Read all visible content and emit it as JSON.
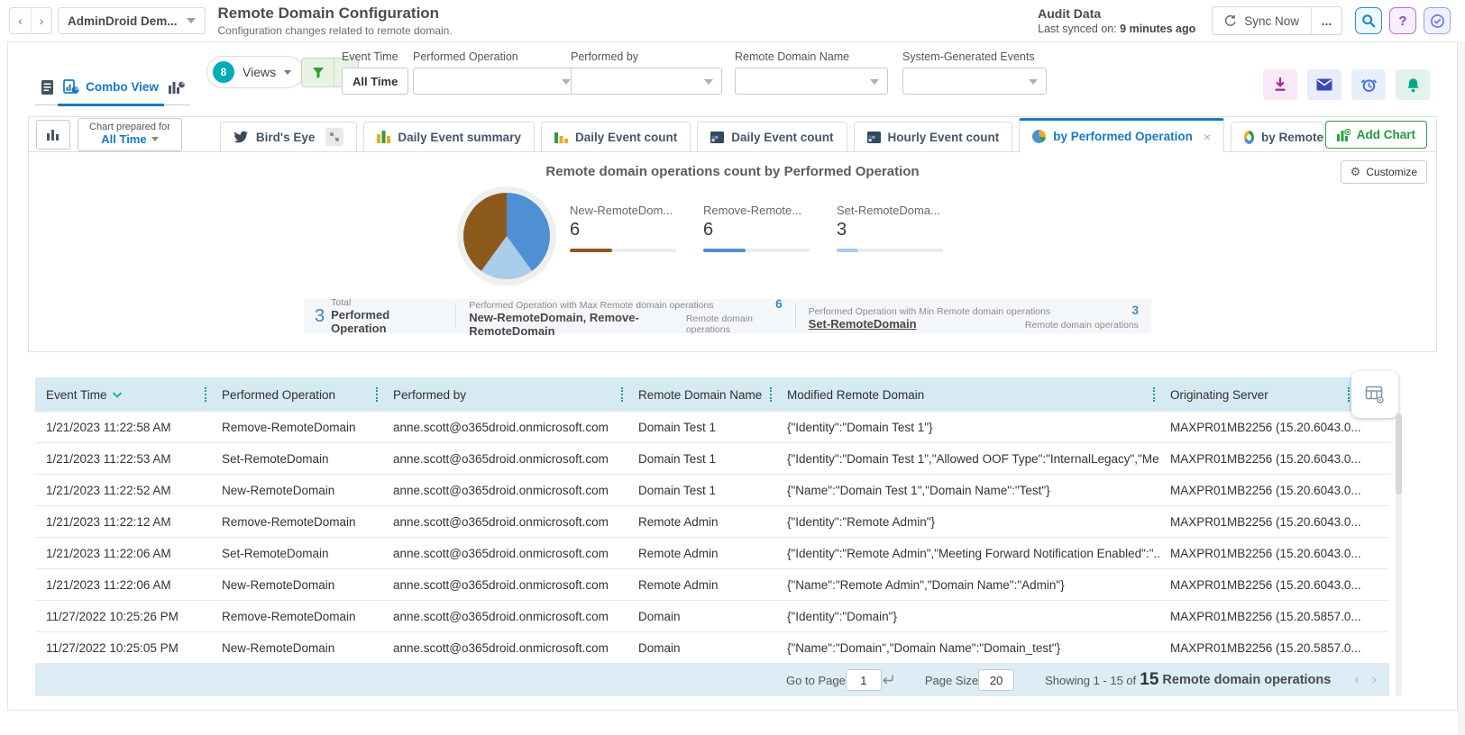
{
  "header": {
    "nav_back": "‹",
    "nav_forward": "›",
    "workspace": "AdminDroid Dem...",
    "title": "Remote Domain Configuration",
    "subtitle": "Configuration changes related to remote domain.",
    "audit_label": "Audit Data",
    "synced_prefix": "Last synced on: ",
    "synced_value": "9 minutes ago",
    "sync_button": "Sync Now",
    "more_label": "...",
    "help_label": "?"
  },
  "viewbar": {
    "combo_label": "Combo View",
    "views_badge": "8",
    "views_label": "Views"
  },
  "filters": {
    "event_time_label": "Event Time",
    "event_time_value": "All Time",
    "dropdowns": [
      {
        "label": "Performed Operation",
        "value": ""
      },
      {
        "label": "Performed by",
        "value": ""
      },
      {
        "label": "Remote Domain Name",
        "value": ""
      },
      {
        "label": "System-Generated Events",
        "value": ""
      }
    ]
  },
  "chartbar": {
    "prepared_line1": "Chart prepared for",
    "prepared_line2": "All Time",
    "tabs": [
      {
        "label": "Bird's Eye"
      },
      {
        "label": "Daily Event summary"
      },
      {
        "label": "Daily Event count"
      },
      {
        "label": "Daily Event count"
      },
      {
        "label": "Hourly Event count"
      },
      {
        "label": "by Performed Operation",
        "active": true
      },
      {
        "label": "by Remote"
      }
    ],
    "add_chart": "Add Chart",
    "customize": "Customize"
  },
  "chart_data": {
    "type": "pie",
    "title": "Remote domain operations count by Performed Operation",
    "series": [
      {
        "name": "New-RemoteDomain",
        "short": "New-RemoteDom...",
        "value": 6,
        "color": "#8B5A1B"
      },
      {
        "name": "Remove-RemoteDomain",
        "short": "Remove-Remote...",
        "value": 6,
        "color": "#4E90D2"
      },
      {
        "name": "Set-RemoteDomain",
        "short": "Set-RemoteDoma...",
        "value": 3,
        "color": "#A9CCE9"
      }
    ],
    "total": 15,
    "pie_order": [
      1,
      2,
      0
    ],
    "legend_position": "right"
  },
  "summary": {
    "total_value": "3",
    "total_caption": "Total",
    "total_label": "Performed Operation",
    "max_caption": "Performed Operation with Max Remote domain operations",
    "max_names": "New-RemoteDomain, Remove-RemoteDomain",
    "max_value": "6",
    "max_unit": "Remote domain operations",
    "min_caption": "Performed Operation with Min Remote domain operations",
    "min_names": "Set-RemoteDomain",
    "min_value": "3",
    "min_unit": "Remote domain operations"
  },
  "table": {
    "columns": [
      "Event Time",
      "Performed Operation",
      "Performed by",
      "Remote Domain Name",
      "Modified Remote Domain",
      "Originating Server"
    ],
    "rows": [
      [
        "1/21/2023 11:22:58 AM",
        "Remove-RemoteDomain",
        "anne.scott@o365droid.onmicrosoft.com",
        "Domain Test 1",
        "{\"Identity\":\"Domain Test 1\"}",
        "MAXPR01MB2256 (15.20.6043.0..."
      ],
      [
        "1/21/2023 11:22:53 AM",
        "Set-RemoteDomain",
        "anne.scott@o365droid.onmicrosoft.com",
        "Domain Test 1",
        "{\"Identity\":\"Domain Test 1\",\"Allowed OOF Type\":\"InternalLegacy\",\"Me...",
        "MAXPR01MB2256 (15.20.6043.0..."
      ],
      [
        "1/21/2023 11:22:52 AM",
        "New-RemoteDomain",
        "anne.scott@o365droid.onmicrosoft.com",
        "Domain Test 1",
        "{\"Name\":\"Domain Test 1\",\"Domain Name\":\"Test\"}",
        "MAXPR01MB2256 (15.20.6043.0..."
      ],
      [
        "1/21/2023 11:22:12 AM",
        "Remove-RemoteDomain",
        "anne.scott@o365droid.onmicrosoft.com",
        "Remote Admin",
        "{\"Identity\":\"Remote Admin\"}",
        "MAXPR01MB2256 (15.20.6043.0..."
      ],
      [
        "1/21/2023 11:22:06 AM",
        "Set-RemoteDomain",
        "anne.scott@o365droid.onmicrosoft.com",
        "Remote Admin",
        "{\"Identity\":\"Remote Admin\",\"Meeting Forward Notification Enabled\":\"...",
        "MAXPR01MB2256 (15.20.6043.0..."
      ],
      [
        "1/21/2023 11:22:06 AM",
        "New-RemoteDomain",
        "anne.scott@o365droid.onmicrosoft.com",
        "Remote Admin",
        "{\"Name\":\"Remote Admin\",\"Domain Name\":\"Admin\"}",
        "MAXPR01MB2256 (15.20.6043.0..."
      ],
      [
        "11/27/2022 10:25:26 PM",
        "Remove-RemoteDomain",
        "anne.scott@o365droid.onmicrosoft.com",
        "Domain",
        "{\"Identity\":\"Domain\"}",
        "MAXPR01MB2256 (15.20.5857.0..."
      ],
      [
        "11/27/2022 10:25:05 PM",
        "New-RemoteDomain",
        "anne.scott@o365droid.onmicrosoft.com",
        "Domain",
        "{\"Name\":\"Domain\",\"Domain Name\":\"Domain_test\"}",
        "MAXPR01MB2256 (15.20.5857.0..."
      ]
    ]
  },
  "pagination": {
    "goto_label": "Go to Page",
    "goto_value": "1",
    "size_label": "Page Size",
    "size_value": "20",
    "showing_text": "Showing 1 - 15 of",
    "total": "15",
    "unit": "Remote domain operations"
  },
  "colors": {
    "accent_blue": "#1779c4",
    "teal": "#00a693",
    "green": "#28a246",
    "table_header_bg": "#d6eaf3",
    "footer_bg": "#dcedf5"
  }
}
